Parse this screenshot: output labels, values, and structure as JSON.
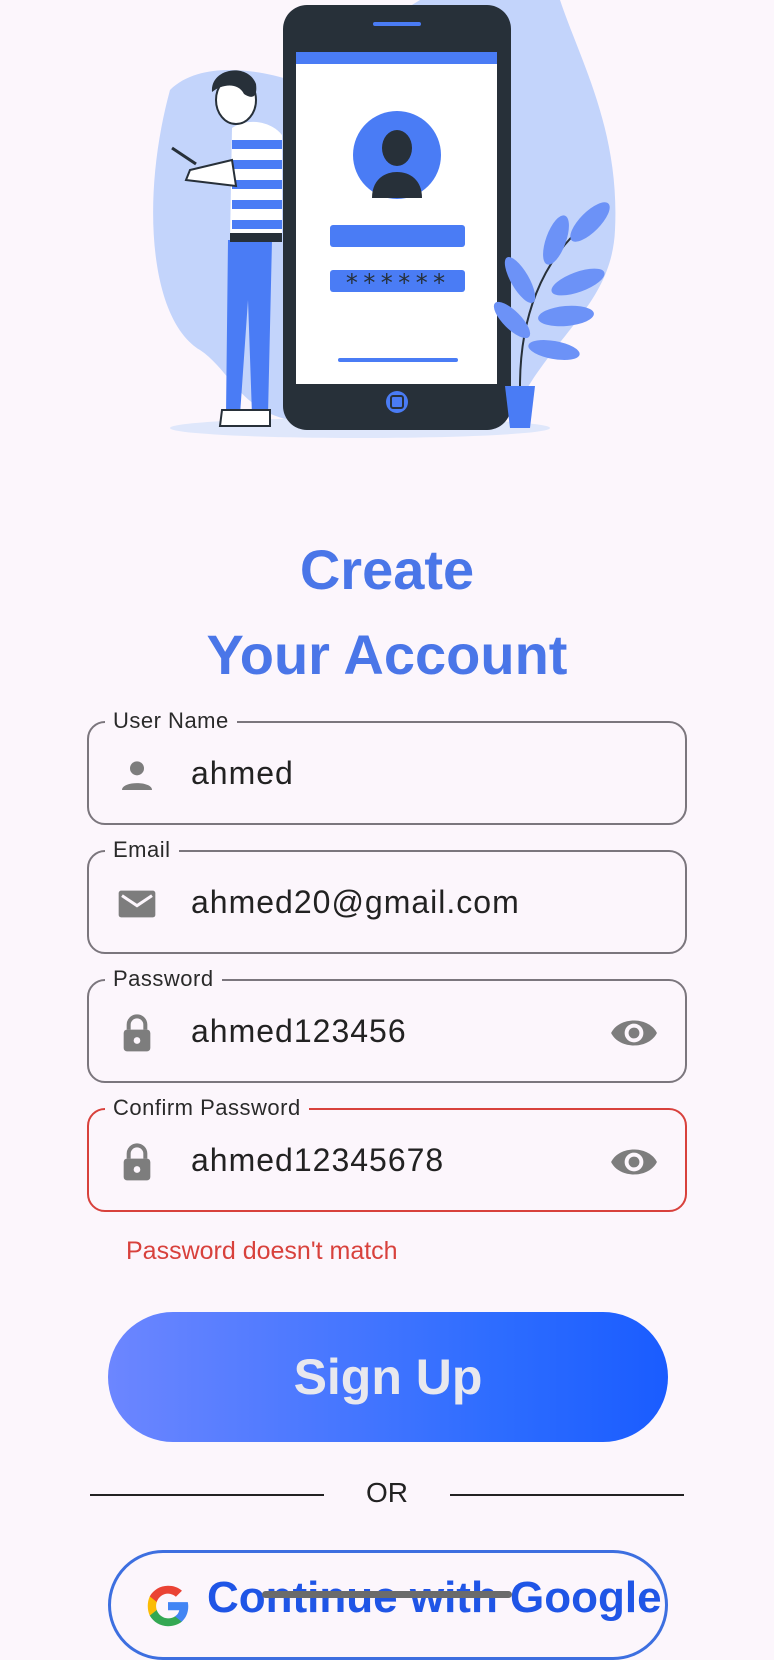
{
  "heading": {
    "line1": "Create",
    "line2": "Your Account"
  },
  "illustration": {
    "password_mask": "******"
  },
  "fields": {
    "username": {
      "label": "User Name",
      "value": "ahmed",
      "icon": "person-icon"
    },
    "email": {
      "label": "Email",
      "value": "ahmed20@gmail.com",
      "icon": "mail-icon"
    },
    "password": {
      "label": "Password",
      "value": "ahmed123456",
      "icon": "lock-icon",
      "toggle_icon": "eye-icon"
    },
    "confirm_password": {
      "label": "Confirm Password",
      "value": "ahmed12345678",
      "icon": "lock-icon",
      "toggle_icon": "eye-icon",
      "error": "Password doesn't match"
    }
  },
  "signup_button": {
    "label": "Sign Up"
  },
  "divider": {
    "label": "OR"
  },
  "google_button": {
    "label": "Continue with Google"
  },
  "colors": {
    "accent": "#4a76e8",
    "error": "#d8413c",
    "background": "#fcf6fc",
    "button_gradient_start": "#6c86ff",
    "button_gradient_end": "#1a5cff"
  }
}
